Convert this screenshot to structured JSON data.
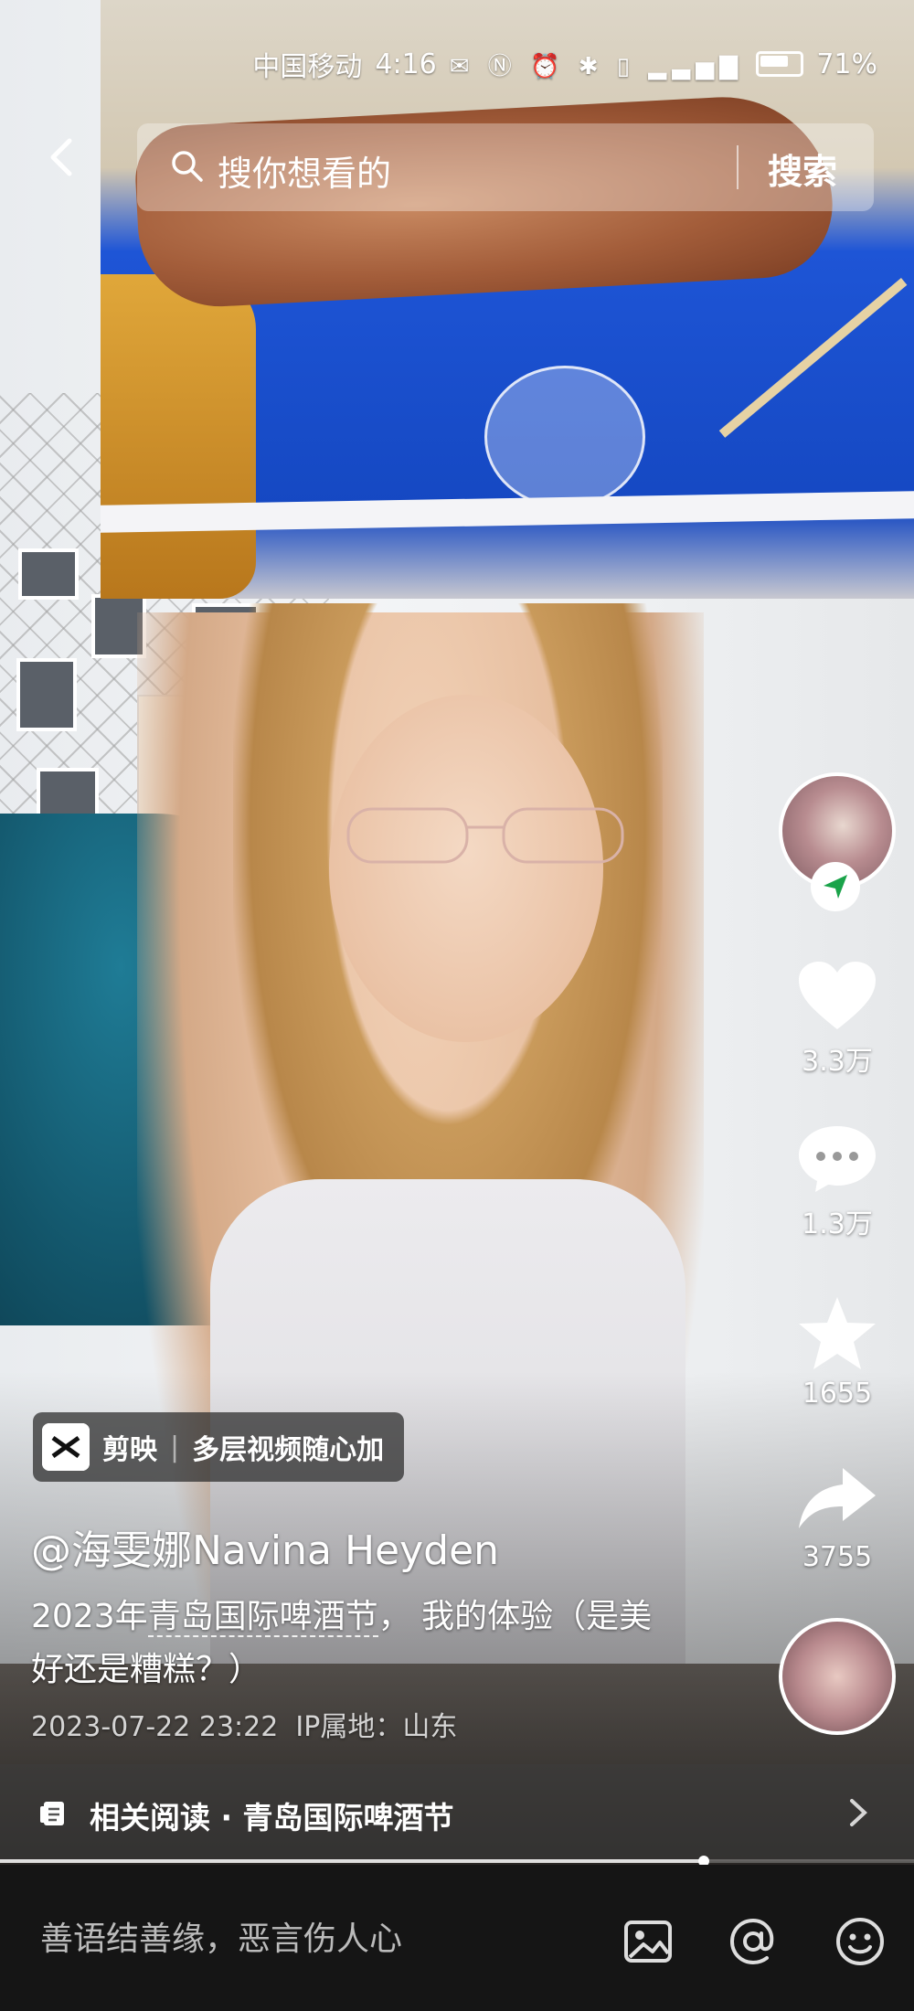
{
  "status_bar": {
    "carrier": "中国移动",
    "time": "4:16",
    "battery": "71%",
    "icons": [
      "mail-icon",
      "nfc-icon",
      "alarm-icon",
      "bluetooth-icon",
      "vibrate-icon",
      "signal-4g-icon",
      "battery-icon"
    ]
  },
  "search": {
    "placeholder": "搜你想看的",
    "button": "搜索"
  },
  "rail": {
    "likes": "3.3万",
    "comments": "1.3万",
    "favorites": "1655",
    "shares": "3755"
  },
  "badge": {
    "app": "剪映",
    "slogan": "多层视频随心加"
  },
  "post": {
    "author": "@海雯娜Navina Heyden",
    "caption_prefix": "2023年",
    "caption_tag": "青岛国际啤酒节",
    "caption_rest": "， 我的体验（是美好还是糟糕？）",
    "date": "2023-07-22 23:22",
    "ip": "IP属地：山东"
  },
  "related": {
    "label": "相关阅读 · 青岛国际啤酒节"
  },
  "progress": {
    "played_fraction": 0.77
  },
  "comment_bar": {
    "placeholder": "善语结善缘，恶言伤人心"
  }
}
